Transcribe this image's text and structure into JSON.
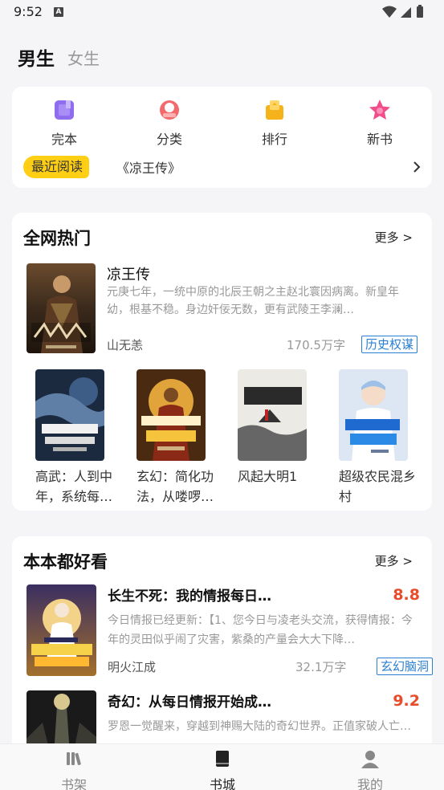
{
  "status": {
    "time": "9:52",
    "notification_letter": "A"
  },
  "gender_tabs": {
    "active": "男生",
    "inactive": "女生"
  },
  "quick_nav": [
    {
      "label": "完本",
      "icon": "book-icon",
      "color": "#8f6cf0"
    },
    {
      "label": "分类",
      "icon": "category-icon",
      "color": "#f26a6a"
    },
    {
      "label": "排行",
      "icon": "ranking-icon",
      "color": "#f5b21b"
    },
    {
      "label": "新书",
      "icon": "star-icon",
      "color": "#f04e8a"
    }
  ],
  "recent": {
    "badge": "最近阅读",
    "title": "《凉王传》"
  },
  "hot_section": {
    "title": "全网热门",
    "more": "更多 >",
    "featured": {
      "title": "凉王传",
      "description": "元庚七年，一统中原的北辰王朝之主赵北寰因病离。新皇年幼，根基不稳。身边奸佞无数，更有武陵王李澜…",
      "author": "山无恙",
      "words": "170.5万字",
      "tag": "历史权谋"
    },
    "grid": [
      {
        "title": "高武：人到中年，系统每…"
      },
      {
        "title": "玄幻：简化功法，从喽啰…"
      },
      {
        "title": "风起大明1"
      },
      {
        "title": "超级农民混乡村"
      }
    ]
  },
  "good_section": {
    "title": "本本都好看",
    "more": "更多 >",
    "items": [
      {
        "title": "长生不死：我的情报每日…",
        "score": "8.8",
        "description": "今日情报已经更新：【1、您今日与凌老头交流，获得情报：今年的灵田似乎闹了灾害，紫桑的产量会大大下降…",
        "author": "明火江成",
        "words": "32.1万字",
        "tag": "玄幻脑洞"
      },
      {
        "title": "奇幻：从每日情报开始成…",
        "score": "9.2",
        "description": "罗恩一觉醒来，穿越到神赐大陆的奇幻世界。正值家破人亡…"
      }
    ]
  },
  "bottom_nav": [
    {
      "label": "书架",
      "icon": "bookshelf-icon"
    },
    {
      "label": "书城",
      "icon": "bookstore-icon"
    },
    {
      "label": "我的",
      "icon": "profile-icon"
    }
  ],
  "colors": {
    "accent_yellow": "#ffcf16",
    "tag_blue": "#2a7fd4",
    "score_red": "#ea4b2a"
  }
}
